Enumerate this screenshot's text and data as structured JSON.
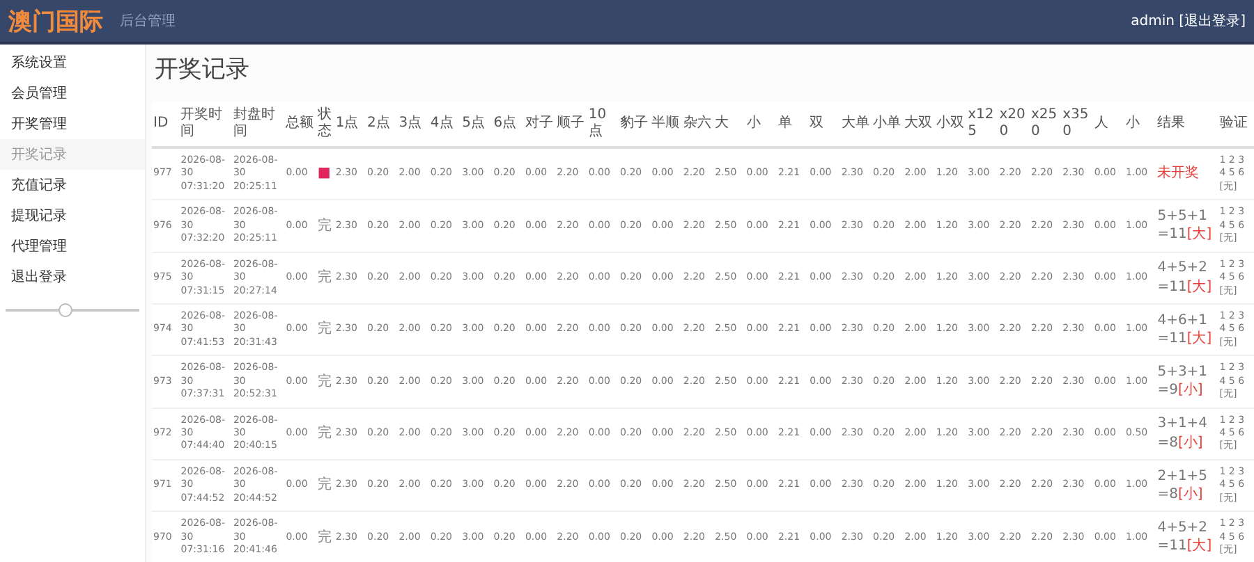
{
  "header": {
    "logo": "澳门国际",
    "subtitle": "后台管理",
    "user": "admin [退出登录]"
  },
  "sidebar": {
    "items": [
      {
        "label": "系统设置",
        "selected": false
      },
      {
        "label": "会员管理",
        "selected": false
      },
      {
        "label": "开奖管理",
        "selected": false
      },
      {
        "label": "开奖记录",
        "selected": true
      },
      {
        "label": "充值记录",
        "selected": false
      },
      {
        "label": "提现记录",
        "selected": false
      },
      {
        "label": "代理管理",
        "selected": false
      },
      {
        "label": "退出登录",
        "selected": false
      }
    ],
    "slider": {
      "level": 0.45
    }
  },
  "page_title": "开奖记录",
  "table": {
    "columns": [
      "ID",
      "开奖时间",
      "封盘时间",
      "总额",
      "状态",
      "1点",
      "2点",
      "3点",
      "4点",
      "5点",
      "6点",
      "对子",
      "顺子",
      "10点",
      "豹子",
      "半顺",
      "杂六",
      "大",
      "小",
      "单",
      "双",
      "大单",
      "小单",
      "大双",
      "小双",
      "x125",
      "x200",
      "x250",
      "x350",
      "人",
      "小",
      "结果",
      "验证"
    ],
    "rows": [
      {
        "id": "977",
        "open_time": "2026-08-30 07:31:20",
        "close_time": "2026-08-30 20:25:11",
        "total": "0.00",
        "status": {
          "text": "■",
          "kind": "pending"
        },
        "values": [
          "2.30",
          "0.20",
          "2.00",
          "0.20",
          "3.00",
          "0.20",
          "0.00",
          "2.20",
          "0.00",
          "0.20",
          "0.00",
          "2.20",
          "2.50",
          "0.00",
          "2.21",
          "0.00",
          "2.30",
          "0.20",
          "2.00",
          "1.20",
          "3.00",
          "2.20",
          "2.20",
          "2.30",
          "0.00",
          "1.00"
        ],
        "result": {
          "text": "未开奖",
          "kind": "pending"
        },
        "verify": "1 2 3 4 5 6 [无]"
      },
      {
        "id": "976",
        "open_time": "2026-08-30 07:32:20",
        "close_time": "2026-08-30 20:25:11",
        "total": "0.00",
        "status": {
          "text": "完",
          "kind": "done"
        },
        "values": [
          "2.30",
          "0.20",
          "2.00",
          "0.20",
          "3.00",
          "0.20",
          "0.00",
          "2.20",
          "0.00",
          "0.20",
          "0.00",
          "2.20",
          "2.50",
          "0.00",
          "2.21",
          "0.00",
          "2.30",
          "0.20",
          "2.00",
          "1.20",
          "3.00",
          "2.20",
          "2.20",
          "2.30",
          "0.00",
          "1.00"
        ],
        "result": {
          "text": "5+5+1=11",
          "tag": "[大]",
          "kind": "done"
        },
        "verify": "1 2 3 4 5 6 [无]"
      },
      {
        "id": "975",
        "open_time": "2026-08-30 07:31:15",
        "close_time": "2026-08-30 20:27:14",
        "total": "0.00",
        "status": {
          "text": "完",
          "kind": "done"
        },
        "values": [
          "2.30",
          "0.20",
          "2.00",
          "0.20",
          "3.00",
          "0.20",
          "0.00",
          "2.20",
          "0.00",
          "0.20",
          "0.00",
          "2.20",
          "2.50",
          "0.00",
          "2.21",
          "0.00",
          "2.30",
          "0.20",
          "2.00",
          "1.20",
          "3.00",
          "2.20",
          "2.20",
          "2.30",
          "0.00",
          "1.00"
        ],
        "result": {
          "text": "4+5+2=11",
          "tag": "[大]",
          "kind": "done"
        },
        "verify": "1 2 3 4 5 6 [无]"
      },
      {
        "id": "974",
        "open_time": "2026-08-30 07:41:53",
        "close_time": "2026-08-30 20:31:43",
        "total": "0.00",
        "status": {
          "text": "完",
          "kind": "done"
        },
        "values": [
          "2.30",
          "0.20",
          "2.00",
          "0.20",
          "3.00",
          "0.20",
          "0.00",
          "2.20",
          "0.00",
          "0.20",
          "0.00",
          "2.20",
          "2.50",
          "0.00",
          "2.21",
          "0.00",
          "2.30",
          "0.20",
          "2.00",
          "1.20",
          "3.00",
          "2.20",
          "2.20",
          "2.30",
          "0.00",
          "1.00"
        ],
        "result": {
          "text": "4+6+1=11",
          "tag": "[大]",
          "kind": "done"
        },
        "verify": "1 2 3 4 5 6 [无]"
      },
      {
        "id": "973",
        "open_time": "2026-08-30 07:37:31",
        "close_time": "2026-08-30 20:52:31",
        "total": "0.00",
        "status": {
          "text": "完",
          "kind": "done"
        },
        "values": [
          "2.30",
          "0.20",
          "2.00",
          "0.20",
          "3.00",
          "0.20",
          "0.00",
          "2.20",
          "0.00",
          "0.20",
          "0.00",
          "2.20",
          "2.50",
          "0.00",
          "2.21",
          "0.00",
          "2.30",
          "0.20",
          "2.00",
          "1.20",
          "3.00",
          "2.20",
          "2.20",
          "2.30",
          "0.00",
          "1.00"
        ],
        "result": {
          "text": "5+3+1=9",
          "tag": "[小]",
          "kind": "done"
        },
        "verify": "1 2 3 4 5 6 [无]"
      },
      {
        "id": "972",
        "open_time": "2026-08-30 07:44:40",
        "close_time": "2026-08-30 20:40:15",
        "total": "0.00",
        "status": {
          "text": "完",
          "kind": "done"
        },
        "values": [
          "2.30",
          "0.20",
          "2.00",
          "0.20",
          "3.00",
          "0.20",
          "0.00",
          "2.20",
          "0.00",
          "0.20",
          "0.00",
          "2.20",
          "2.50",
          "0.00",
          "2.21",
          "0.00",
          "2.30",
          "0.20",
          "2.00",
          "1.20",
          "3.00",
          "2.20",
          "2.20",
          "2.30",
          "0.00",
          "0.50"
        ],
        "result": {
          "text": "3+1+4=8",
          "tag": "[小]",
          "kind": "done"
        },
        "verify": "1 2 3 4 5 6 [无]"
      },
      {
        "id": "971",
        "open_time": "2026-08-30 07:44:52",
        "close_time": "2026-08-30 20:44:52",
        "total": "0.00",
        "status": {
          "text": "完",
          "kind": "done"
        },
        "values": [
          "2.30",
          "0.20",
          "2.00",
          "0.20",
          "3.00",
          "0.20",
          "0.00",
          "2.20",
          "0.00",
          "0.20",
          "0.00",
          "2.20",
          "2.50",
          "0.00",
          "2.21",
          "0.00",
          "2.30",
          "0.20",
          "2.00",
          "1.20",
          "3.00",
          "2.20",
          "2.20",
          "2.30",
          "0.00",
          "1.00"
        ],
        "result": {
          "text": "2+1+5=8",
          "tag": "[小]",
          "kind": "done"
        },
        "verify": "1 2 3 4 5 6 [无]"
      },
      {
        "id": "970",
        "open_time": "2026-08-30 07:31:16",
        "close_time": "2026-08-30 20:41:46",
        "total": "0.00",
        "status": {
          "text": "完",
          "kind": "done"
        },
        "values": [
          "2.30",
          "0.20",
          "2.00",
          "0.20",
          "3.00",
          "0.20",
          "0.00",
          "2.20",
          "0.00",
          "0.20",
          "0.00",
          "2.20",
          "2.50",
          "0.00",
          "2.21",
          "0.00",
          "2.30",
          "0.20",
          "2.00",
          "1.20",
          "3.00",
          "2.20",
          "2.20",
          "2.30",
          "0.00",
          "1.00"
        ],
        "result": {
          "text": "4+5+2=11",
          "tag": "[大]",
          "kind": "done"
        },
        "verify": "1 2 3 4 5 6 [无]"
      }
    ]
  }
}
